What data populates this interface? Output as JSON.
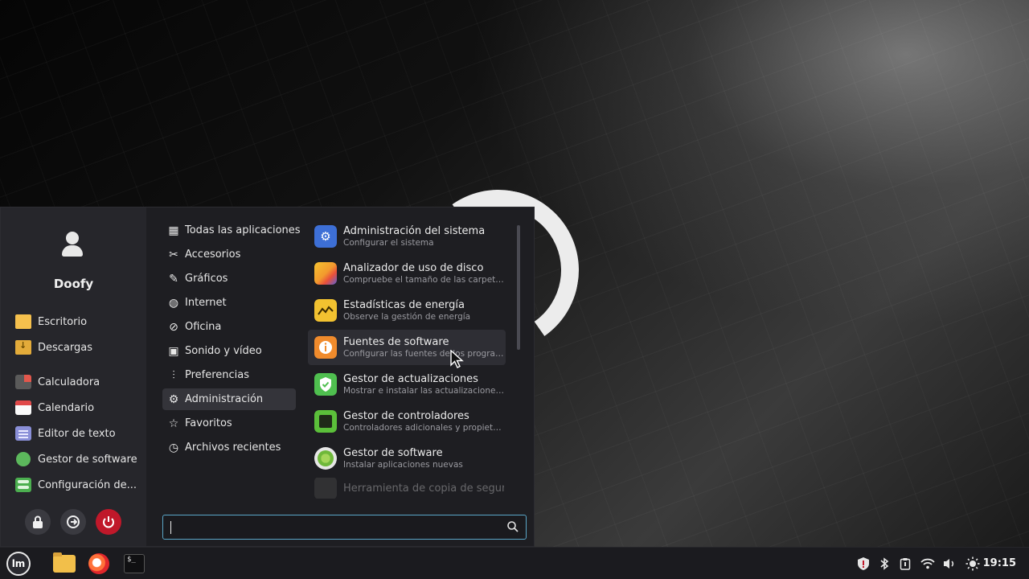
{
  "user": {
    "name": "Doofy"
  },
  "favorites": [
    {
      "label": "Escritorio",
      "icon": "folder-desktop-icon"
    },
    {
      "label": "Descargas",
      "icon": "folder-downloads-icon"
    },
    {
      "label": "Calculadora",
      "icon": "calculator-icon"
    },
    {
      "label": "Calendario",
      "icon": "calendar-icon"
    },
    {
      "label": "Editor de texto",
      "icon": "text-editor-icon"
    },
    {
      "label": "Gestor de software",
      "icon": "software-manager-icon"
    },
    {
      "label": "Configuración de...",
      "icon": "settings-icon"
    }
  ],
  "session": {
    "lock": "lock-icon",
    "logout": "logout-icon",
    "power": "power-icon"
  },
  "categories": [
    {
      "label": "Todas las aplicaciones",
      "icon": "grid-icon"
    },
    {
      "label": "Accesorios",
      "icon": "tools-icon"
    },
    {
      "label": "Gráficos",
      "icon": "brush-icon"
    },
    {
      "label": "Internet",
      "icon": "globe-icon"
    },
    {
      "label": "Oficina",
      "icon": "paperclip-icon"
    },
    {
      "label": "Sonido y vídeo",
      "icon": "media-icon"
    },
    {
      "label": "Preferencias",
      "icon": "sliders-icon"
    },
    {
      "label": "Administración",
      "icon": "gear-icon",
      "active": true
    },
    {
      "label": "Favoritos",
      "icon": "star-icon"
    },
    {
      "label": "Archivos recientes",
      "icon": "history-icon"
    }
  ],
  "apps": [
    {
      "name": "Administración del sistema",
      "desc": "Configurar el sistema",
      "color": "#3d6fd6"
    },
    {
      "name": "Analizador de uso de disco",
      "desc": "Compruebe el tamaño de las carpetas y el espacio disponible",
      "color": "#f29a2e"
    },
    {
      "name": "Estadísticas de energía",
      "desc": "Observe la gestión de energía",
      "color": "#f2c230"
    },
    {
      "name": "Fuentes de software",
      "desc": "Configurar las fuentes de los programas instalables",
      "color": "#f08b2c"
    },
    {
      "name": "Gestor de actualizaciones",
      "desc": "Mostrar e instalar las actualizaciones disponibles",
      "color": "#4fbf4f"
    },
    {
      "name": "Gestor de controladores",
      "desc": "Controladores adicionales y propietarios",
      "color": "#5bbf3a"
    },
    {
      "name": "Gestor de software",
      "desc": "Instalar aplicaciones nuevas",
      "color": "#8bc34a"
    },
    {
      "name": "Herramienta de copia de seguridad",
      "desc": "",
      "color": "#555555"
    }
  ],
  "search": {
    "value": "",
    "placeholder": ""
  },
  "taskbar": {
    "menu_logo": "lm",
    "terminal_prompt": "$_",
    "clock": "19:15"
  }
}
